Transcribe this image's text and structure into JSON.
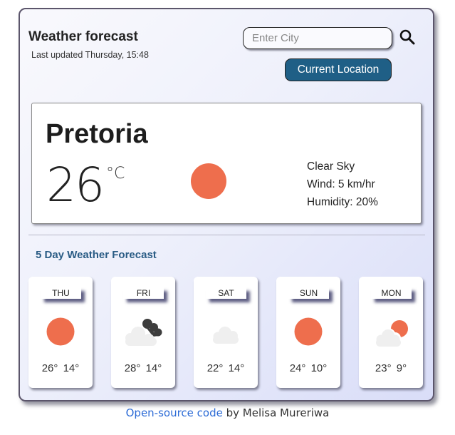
{
  "header": {
    "title": "Weather forecast",
    "last_updated": "Last updated Thursday, 15:48"
  },
  "search": {
    "placeholder": "Enter City",
    "value": "",
    "search_icon": "search-icon",
    "current_location_label": "Current Location"
  },
  "current": {
    "city": "Pretoria",
    "temperature": "26",
    "unit": "°C",
    "icon": "sun-icon",
    "description": "Clear Sky",
    "wind": "Wind: 5 km/hr",
    "humidity": "Humidity: 20%"
  },
  "forecast": {
    "title": "5 Day Weather Forecast",
    "days": [
      {
        "day": "THU",
        "icon": "sun-icon",
        "max": "26°",
        "min": "14°"
      },
      {
        "day": "FRI",
        "icon": "cloud-dark-cloud-icon",
        "max": "28°",
        "min": "14°"
      },
      {
        "day": "SAT",
        "icon": "cloud-icon",
        "max": "22°",
        "min": "14°"
      },
      {
        "day": "SUN",
        "icon": "sun-icon",
        "max": "24°",
        "min": "10°"
      },
      {
        "day": "MON",
        "icon": "cloud-sun-icon",
        "max": "23°",
        "min": "9°"
      }
    ]
  },
  "footer": {
    "link_text": "Open-source code",
    "suffix": " by Melisa Mureriwa"
  },
  "colors": {
    "sun": "#ee6e4d",
    "button": "#1f5f86",
    "forecast_title": "#2a5c85",
    "link": "#2c6bd6"
  }
}
